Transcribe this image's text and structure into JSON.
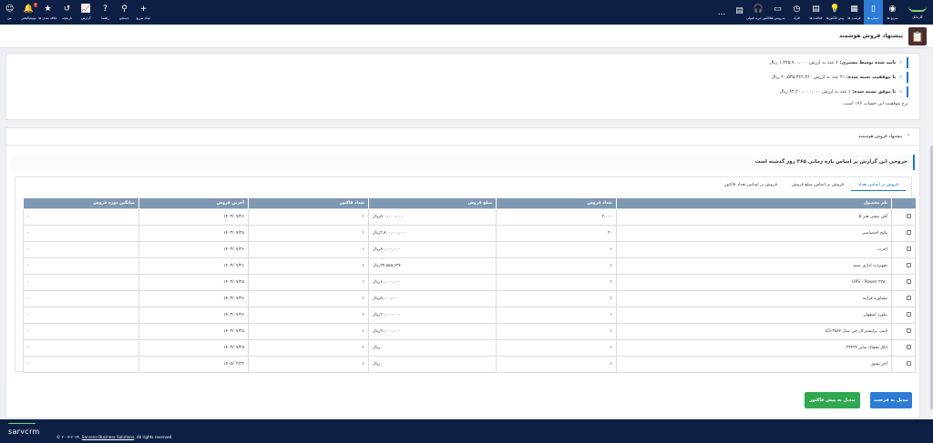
{
  "nav": {
    "logo_label": "کارتابل",
    "items": [
      {
        "icon": "home-icon",
        "glyph": "◉",
        "label": "سرنخ ها"
      },
      {
        "icon": "contracts-icon",
        "glyph": "▯",
        "label": "حساب ها",
        "active": true
      },
      {
        "icon": "opportunity-icon",
        "glyph": "▦",
        "label": "فرصت ها"
      },
      {
        "icon": "bulb-icon",
        "glyph": "💡",
        "label": "پیش فاکتورها"
      },
      {
        "icon": "document-icon",
        "glyph": "▤",
        "label": "فعالیت ها"
      },
      {
        "icon": "clock-icon",
        "glyph": "◷",
        "label": "افراد"
      },
      {
        "icon": "card-icon",
        "glyph": "▭",
        "label": "سرویس ها"
      },
      {
        "icon": "headset-icon",
        "glyph": "🎧",
        "label": "فاکتور خرید قبولی"
      },
      {
        "icon": "file-icon",
        "glyph": "▤",
        "label": ""
      }
    ],
    "more_label": "...",
    "left_items": [
      {
        "icon": "plus-icon",
        "glyph": "+",
        "label": "ایجاد سریع"
      },
      {
        "icon": "search-icon",
        "glyph": "⚲",
        "label": "جستجو"
      },
      {
        "icon": "help-icon",
        "glyph": "?",
        "label": "راهنما"
      },
      {
        "icon": "chart-icon",
        "glyph": "📈",
        "label": "گزارش"
      },
      {
        "icon": "history-icon",
        "glyph": "↺",
        "label": "تاریخچه"
      },
      {
        "icon": "star-icon",
        "glyph": "★",
        "label": "علاقه مندی ها"
      },
      {
        "icon": "bell-icon",
        "glyph": "🔔",
        "label": "نوتیفیکیشن",
        "badge": "۲"
      },
      {
        "icon": "avatar-icon",
        "glyph": "☺",
        "label": "من"
      }
    ]
  },
  "page": {
    "title": "پیشنهاد فروش هوشمند",
    "icon_glyph": "📋"
  },
  "stats": [
    {
      "label": "تایید شده توسط مشتری:",
      "text": "۶ عدد به ارزش ۱,۲۷۵,۷۰۰,۰۰۰ ریال",
      "check": "✓"
    },
    {
      "label": "با موفقیت بسته شده:",
      "text": "۲۱ عدد به ارزش ۲۰,۵۳۵,۳۶۲,۳۶۰ ریال",
      "check": "✓"
    },
    {
      "label": "نا موفق بسته شده:",
      "text": "۱ عدد به ارزش ۶۳,۲۰۰,۰۰۰,۰۰۰ ریال",
      "check": "✓"
    }
  ],
  "success_note": "نرخ موفقیت این حساب ۹۶٪ است.",
  "section": {
    "title": "پیشنهاد فروش هوشمند",
    "banner": "خروجی این گزارش بر اساس بازه زمانی ۳۶۵ روز گذشته است"
  },
  "tabs": [
    {
      "label": "فروش بر اساس تعداد",
      "active": true
    },
    {
      "label": "فروش بر اساس مبلغ فروش",
      "active": false
    },
    {
      "label": "فروش بر اساس تعداد فاکتور",
      "active": false
    }
  ],
  "table": {
    "headers": [
      "",
      "نام محصول",
      "تعداد فروش",
      "مبلغ فروش",
      "تعداد فاکتور",
      "آخرین فروش",
      "میانگین دوره فروش"
    ],
    "rows": [
      [
        "آهن نبشی هنر b",
        "۲,۰۰۰",
        "۵۰۰,۰۰۰,۰۰۰ریال",
        "۱",
        "۱۴۰۳/۰۷/۲۶",
        "-"
      ],
      [
        "پکیج اختصاصی",
        "۲۰",
        "۲,۸۰۰,۰۰۰,۰۰۰ریال",
        "۱",
        "۱۴۰۳/۰۷/۲۵",
        "-"
      ],
      [
        "اجرت",
        "۱",
        "۸۰,۰۰۰,۰۰۰ریال",
        "۱",
        "۱۴۰۳/۰۷/۲۶",
        "-"
      ],
      [
        "تجهیزات اداری صنم",
        "۱",
        "۳۴,۵۵۵,۶۲۴ریال",
        "۱",
        "۱۴۰۳/۰۷/۲۶",
        "-"
      ],
      [
        "UPS - Power ۲۲۸۰",
        "۱",
        "۶۰,۰۰۰,۰۰۰ریال",
        "۱",
        "۱۴۰۳/۰۷/۲۵",
        "-"
      ],
      [
        "مشاوره فرآیند",
        "۱",
        "۵,۰۰۰,۰۰۰ریال",
        "۱",
        "۱۴۰۳/۰۷/۲۶",
        "-"
      ],
      [
        "بیلورد اصفهان",
        "۱",
        "۲۰,۰۰۰,۰۰۰ریال",
        "۱",
        "۱۴۰۳/۰۷/۲۶",
        "-"
      ],
      [
        "لامپ ترانستر ال جی مدل LG-۳۸۸۴",
        "۱",
        "۹۰,۰۰۰,۰۰۰ریال",
        "۱",
        "۱۴۰۳/۰۷/۲۵",
        "-"
      ],
      [
        "اتاق یخچال سایز ۲۳۴۳۴",
        "۱",
        "۰ریال",
        "۱",
        "۱۴۰۳/۰۷/۲۵",
        "-"
      ],
      [
        "آجر نسوز",
        "۱",
        "۰ریال",
        "۱",
        "۱۴۰۵/۰۲/۲۲",
        "-"
      ]
    ]
  },
  "buttons": {
    "convert_opportunity": "تبدیل به فرصت",
    "convert_quote": "تبدیل به پیش فاکتور"
  },
  "footer": {
    "brand": "sarvcrm",
    "copyright_prefix": "© ۲۰۰۴-۲۰۲۴, ",
    "company": "Sarveno Business Solutions",
    "rights": ". All rights reserved."
  }
}
